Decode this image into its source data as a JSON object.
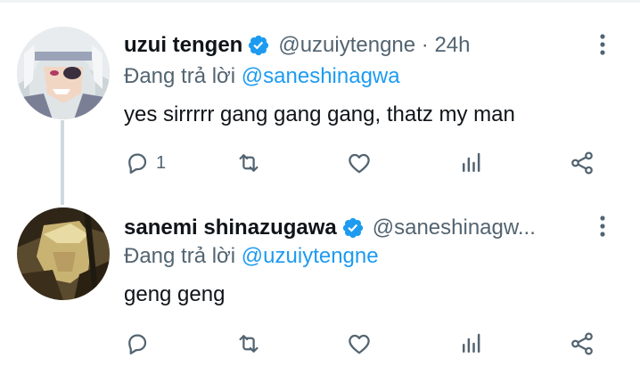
{
  "tweets": [
    {
      "display_name": "uzui tengen",
      "verified": true,
      "handle": "@uzuiytengne",
      "separator": " · ",
      "time": "24h",
      "reply_prefix": "Đang trả lời ",
      "reply_to": "@saneshinagwa",
      "text": "yes sirrrrr gang gang gang, thatz my man",
      "actions": {
        "reply_count": "1"
      }
    },
    {
      "display_name": "sanemi shinazugawa",
      "verified": true,
      "handle": "@saneshinagw...",
      "reply_prefix": "Đang trả lời ",
      "reply_to": "@uzuiytengne",
      "text": "geng geng",
      "actions": {
        "reply_count": ""
      }
    }
  ],
  "colors": {
    "text": "#0f1419",
    "secondary": "#536471",
    "accent": "#1d9bf0",
    "thread_line": "#cfd9de"
  },
  "icons": {
    "verified": "verified-badge-icon",
    "more": "more-vertical-icon",
    "reply": "reply-icon",
    "retweet": "retweet-icon",
    "like": "like-icon",
    "analytics": "analytics-icon",
    "share": "share-icon"
  }
}
